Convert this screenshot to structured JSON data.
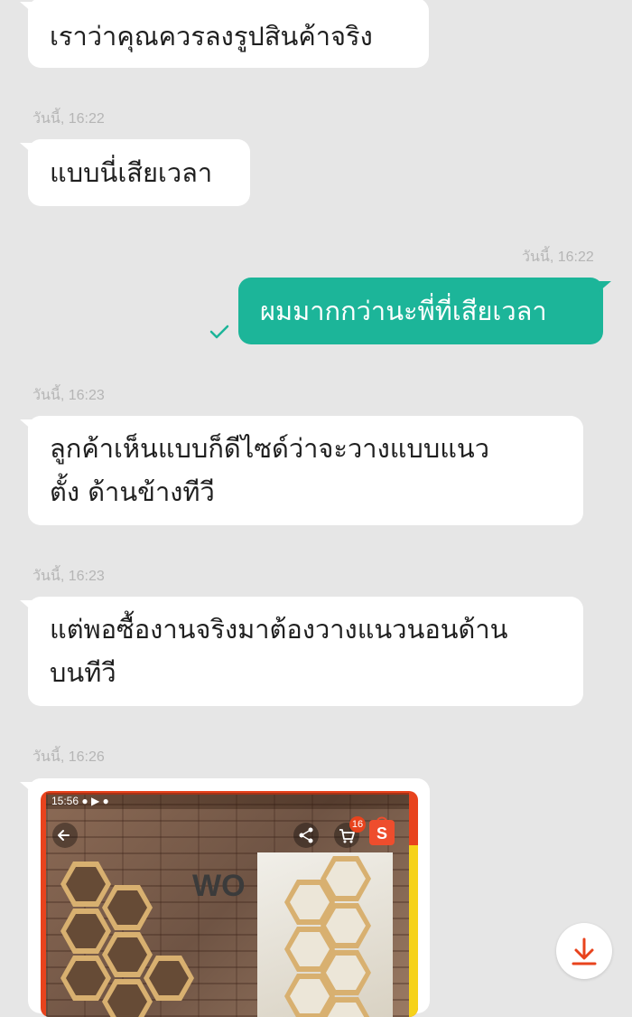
{
  "messages": [
    {
      "id": "m1",
      "direction": "incoming",
      "text": "เราว่าคุณควรลงรูปสินค้าจริง"
    },
    {
      "id": "m2",
      "direction": "incoming",
      "timestamp": "วันนี้, 16:22",
      "text": "แบบนี่เสียเวลา"
    },
    {
      "id": "m3",
      "direction": "outgoing",
      "timestamp": "วันนี้, 16:22",
      "text": "ผมมากกว่านะพี่ที่เสียเวลา",
      "status": "sent"
    },
    {
      "id": "m4",
      "direction": "incoming",
      "timestamp": "วันนี้, 16:23",
      "line1": "ลูกค้าเห็นแบบก็ดีไซด์ว่าจะวางแบบแนว",
      "line2": "ตั้ง ด้านข้างทีวี"
    },
    {
      "id": "m5",
      "direction": "incoming",
      "timestamp": "วันนี้, 16:23",
      "line1": "แต่พอซื้องานจริงมาต้องวางแนวนอนด้าน",
      "line2": "บนทีวี"
    },
    {
      "id": "m6",
      "direction": "incoming",
      "timestamp": "วันนี้, 16:26",
      "type": "image",
      "image": {
        "status_time": "15:56",
        "cart_badge": "16",
        "logo_text": "WO"
      }
    }
  ],
  "colors": {
    "background": "#e6e6e6",
    "incoming_bubble": "#ffffff",
    "outgoing_bubble": "#1cb599",
    "accent": "#e8431d",
    "check": "#1cb599"
  },
  "icons": {
    "check": "check-icon",
    "download": "download-icon",
    "back": "back-arrow-icon",
    "share": "share-icon",
    "cart": "cart-icon",
    "shop": "shopee-icon"
  }
}
